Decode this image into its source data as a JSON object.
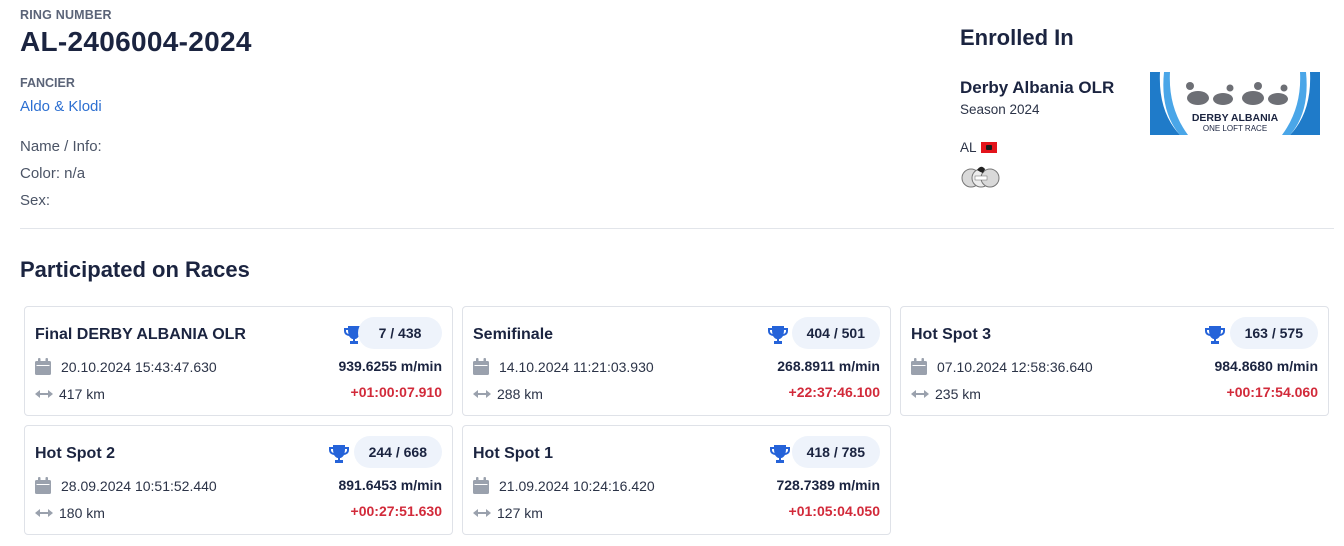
{
  "pigeon": {
    "ring_label": "RING NUMBER",
    "ring_number": "AL-2406004-2024",
    "fancier_label": "FANCIER",
    "fancier_name": "Aldo & Klodi",
    "name_info": "Name / Info:",
    "color": "Color: n/a",
    "sex": "Sex:"
  },
  "enrollment": {
    "title": "Enrolled In",
    "derby_name": "Derby Albania OLR",
    "season": "Season 2024",
    "country_code": "AL",
    "logo_text_line1": "DERBY ALBANIA",
    "logo_text_line2": "ONE LOFT RACE"
  },
  "races": {
    "title": "Participated on Races",
    "items": [
      {
        "name": "Final DERBY ALBANIA OLR",
        "rank": "7 / 438",
        "date": "20.10.2024 15:43:47.630",
        "speed": "939.6255 m/min",
        "distance": "417 km",
        "delay": "+01:00:07.910"
      },
      {
        "name": "Semifinale",
        "rank": "404 / 501",
        "date": "14.10.2024 11:21:03.930",
        "speed": "268.8911 m/min",
        "distance": "288 km",
        "delay": "+22:37:46.100"
      },
      {
        "name": "Hot Spot 3",
        "rank": "163 / 575",
        "date": "07.10.2024 12:58:36.640",
        "speed": "984.8680 m/min",
        "distance": "235 km",
        "delay": "+00:17:54.060"
      },
      {
        "name": "Hot Spot 2",
        "rank": "244 / 668",
        "date": "28.09.2024 10:51:52.440",
        "speed": "891.6453 m/min",
        "distance": "180 km",
        "delay": "+00:27:51.630"
      },
      {
        "name": "Hot Spot 1",
        "rank": "418 / 785",
        "date": "21.09.2024 10:24:16.420",
        "speed": "728.7389 m/min",
        "distance": "127 km",
        "delay": "+01:05:04.050"
      }
    ]
  },
  "colors": {
    "accent_blue": "#2c6fd1",
    "trophy_blue": "#2563d9",
    "delay_red": "#d22a3a",
    "pill_bg": "#eef3fb"
  }
}
